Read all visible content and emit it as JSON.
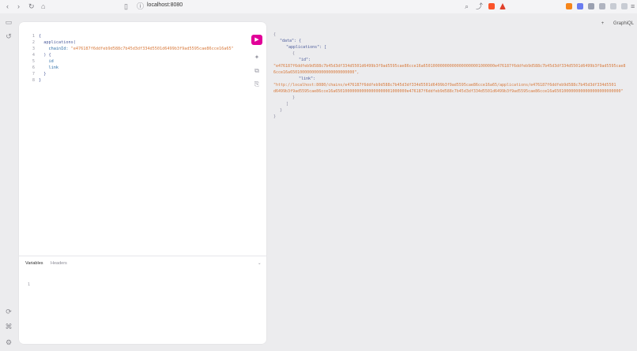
{
  "browser": {
    "url": "localhost:8080"
  },
  "app": {
    "title": "GraphiQL",
    "add_tab": "+"
  },
  "editor": {
    "lines": [
      {
        "n": "1",
        "parts": [
          {
            "t": "{",
            "c": "p"
          }
        ]
      },
      {
        "n": "2",
        "parts": [
          {
            "t": "  applications(",
            "c": "p"
          }
        ]
      },
      {
        "n": "3",
        "parts": [
          {
            "t": "    chainId: ",
            "c": "fld"
          },
          {
            "t": "\"e476187f6ddfeb9d588c7b45d3df334d5501d6499b3f9ad5595cae86cce16a65\"",
            "c": "str"
          }
        ]
      },
      {
        "n": "4",
        "parts": [
          {
            "t": "  ) {",
            "c": "p"
          }
        ]
      },
      {
        "n": "5",
        "parts": [
          {
            "t": "    id",
            "c": "fld"
          }
        ]
      },
      {
        "n": "6",
        "parts": [
          {
            "t": "    link",
            "c": "fld"
          }
        ]
      },
      {
        "n": "7",
        "parts": [
          {
            "t": "  }",
            "c": "p"
          }
        ]
      },
      {
        "n": "8",
        "parts": [
          {
            "t": "}",
            "c": "p"
          }
        ]
      }
    ],
    "run_label": "▶"
  },
  "variables": {
    "tab_variables": "Variables",
    "tab_headers": "Headers",
    "line1": "1"
  },
  "result": {
    "lines": [
      {
        "indent": 0,
        "text": "{",
        "k": ""
      },
      {
        "indent": 1,
        "text": "\"data\": {",
        "k": "data"
      },
      {
        "indent": 2,
        "text": "\"applications\": [",
        "k": "applications"
      },
      {
        "indent": 3,
        "text": "{",
        "k": ""
      },
      {
        "indent": 4,
        "text": "\"id\":",
        "k": "id"
      },
      {
        "indent": 0,
        "text": "\"e476187f6ddfeb9d588c7b45d3df334d5501d6499b3f9ad5595cae86cce16a650100000000000000000001000000e476187f6ddfeb9d588c7b45d3df334d5501d6499b3f9ad5595cae8",
        "k": "val"
      },
      {
        "indent": 0,
        "text": "6cce16a650100000000000000000000000\",",
        "k": "val"
      },
      {
        "indent": 4,
        "text": "\"link\":",
        "k": "link"
      },
      {
        "indent": 0,
        "text": "\"http://localhost:8080/chains/e476187f6ddfeb9d588c7b45d3df334d5501d6499b3f9ad5595cae86cce16a65/applications/e476187f6ddfeb9d588c7b45d3df334d5501",
        "k": "val"
      },
      {
        "indent": 0,
        "text": "d6499b3f9ad5595cae86cce16a650100000000000000000001000000e476187f6ddfeb9d588c7b45d3df334d5501d6499b3f9ad5595cae86cce16a6501000000000000000000000000\"",
        "k": "val"
      },
      {
        "indent": 3,
        "text": "}",
        "k": ""
      },
      {
        "indent": 2,
        "text": "]",
        "k": ""
      },
      {
        "indent": 1,
        "text": "}",
        "k": ""
      },
      {
        "indent": 0,
        "text": "}",
        "k": ""
      }
    ]
  }
}
